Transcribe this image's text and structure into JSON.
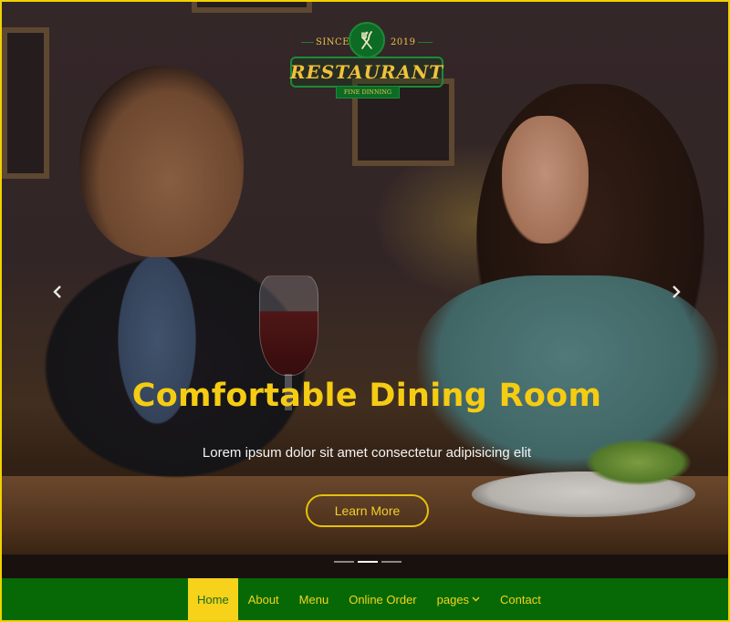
{
  "logo": {
    "since_left": "SINCE",
    "since_right": "2019",
    "name": "RESTAURANT",
    "tagline": "FINE DINNING",
    "badge_icon": "fork-knife-icon"
  },
  "carousel": {
    "prev_icon": "chevron-left-icon",
    "next_icon": "chevron-right-icon",
    "headline": "Comfortable Dining Room",
    "subline": "Lorem ipsum dolor sit amet consectetur adipisicing elit",
    "cta_label": "Learn More",
    "slide_count": 3,
    "active_slide": 2
  },
  "nav": {
    "items": [
      {
        "label": "Home",
        "active": true
      },
      {
        "label": "About",
        "active": false
      },
      {
        "label": "Menu",
        "active": false
      },
      {
        "label": "Online Order",
        "active": false
      },
      {
        "label": "pages",
        "active": false,
        "dropdown": true
      },
      {
        "label": "Contact",
        "active": false
      }
    ]
  },
  "colors": {
    "accent": "#f6d21b",
    "nav_bg": "#066906",
    "frame": "#f0d200"
  }
}
